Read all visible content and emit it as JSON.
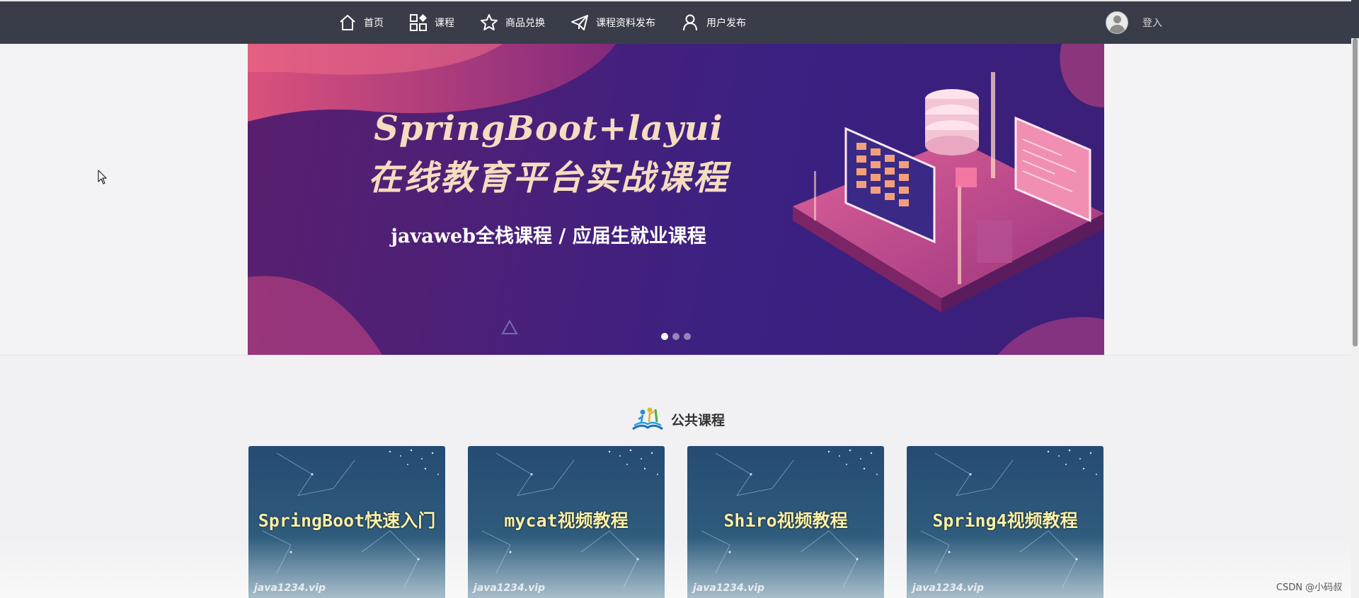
{
  "nav": {
    "items": [
      {
        "label": "首页",
        "icon": "home-icon"
      },
      {
        "label": "课程",
        "icon": "grid-icon"
      },
      {
        "label": "商品兑换",
        "icon": "star-icon"
      },
      {
        "label": "课程资料发布",
        "icon": "send-icon"
      },
      {
        "label": "用户发布",
        "icon": "user-icon"
      }
    ],
    "login_label": "登入"
  },
  "banner": {
    "title_line1": "SpringBoot+layui",
    "title_line2": "在线教育平台实战课程",
    "subtitle": "javaweb全栈课程 / 应届生就业课程",
    "slides_count": 3,
    "active_slide": 1
  },
  "section": {
    "title": "公共课程"
  },
  "courses": [
    {
      "title": "SpringBoot快速入门",
      "footer": "java1234.vip"
    },
    {
      "title": "mycat视频教程",
      "footer": "java1234.vip"
    },
    {
      "title": "Shiro视频教程",
      "footer": "java1234.vip"
    },
    {
      "title": "Spring4视频教程",
      "footer": "java1234.vip"
    }
  ],
  "watermark": "CSDN @小码叔",
  "colors": {
    "topbar": "#393d49",
    "page_bg": "#f1f1f3",
    "banner_title": "#f6dcc0",
    "card_title": "#f8f0a8"
  }
}
